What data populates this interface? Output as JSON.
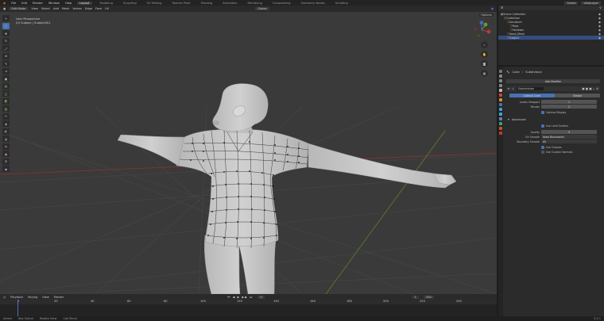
{
  "topbar": {
    "menus": [
      "File",
      "Edit",
      "Render",
      "Window",
      "Help"
    ],
    "workspaces": [
      "Layout",
      "Modeling",
      "Sculpting",
      "UV Editing",
      "Texture Paint",
      "Shading",
      "Animation",
      "Rendering",
      "Compositing",
      "Geometry Nodes",
      "Scripting"
    ],
    "active_workspace": "Layout",
    "scene": "Scene",
    "view_layer": "ViewLayer"
  },
  "viewport_header": {
    "mode": "Edit Mode",
    "menus": [
      "View",
      "Select",
      "Add",
      "Mesh",
      "Vertex",
      "Edge",
      "Face",
      "UV"
    ],
    "transform": "Global"
  },
  "viewport": {
    "view_name": "User Perspective",
    "object_info": "(0) Subject | Subject001",
    "options_label": "Options"
  },
  "timeline": {
    "menus": [
      "Playback",
      "Keying",
      "View",
      "Marker"
    ],
    "current_frame": "0",
    "start": "1",
    "end": "250",
    "ruler": [
      "0",
      "20",
      "40",
      "60",
      "80",
      "100",
      "120",
      "140",
      "160",
      "180",
      "200",
      "220",
      "240"
    ]
  },
  "status_bar": {
    "items": [
      "Select",
      "Box Select",
      "Rotate View",
      "Call Menu"
    ],
    "version": "3.3.1"
  },
  "outliner": {
    "rows": [
      {
        "label": "Scene Collection",
        "indent": 0,
        "selected": false
      },
      {
        "label": "Collection",
        "indent": 1,
        "selected": false
      },
      {
        "label": "Armature",
        "indent": 2,
        "selected": false
      },
      {
        "label": "Pose",
        "indent": 3,
        "selected": false
      },
      {
        "label": "Skeleton",
        "indent": 3,
        "selected": false
      },
      {
        "label": "Head_Mesh",
        "indent": 2,
        "selected": false
      },
      {
        "label": "Subject",
        "indent": 2,
        "selected": true
      }
    ]
  },
  "properties": {
    "object_name": "Cube",
    "modifier_label": "Subdivision",
    "add_modifier": "Add Modifier",
    "modifier_name": "Subdivision",
    "tabs": [
      "Catmull-Clark",
      "Simple"
    ],
    "levels_viewport_label": "Levels Viewport",
    "levels_viewport": "1",
    "render_label": "Render",
    "render": "2",
    "optimal_display": "Optimal Display",
    "advanced_label": "Advanced",
    "use_limit_surface": "Use Limit Surface",
    "quality_label": "Quality",
    "quality": "3",
    "uv_smooth_label": "UV Smooth",
    "uv_smooth": "Keep Boundaries",
    "boundary_smooth_label": "Boundary Smooth",
    "boundary_smooth": "All",
    "use_creases": "Use Creases",
    "use_custom_normals": "Use Custom Normals"
  },
  "colors": {
    "accent": "#4772b3",
    "viewport_bg": "#3a3a3a",
    "mesh": "#c9c9c9",
    "axis_x": "#b53b3b",
    "axis_y": "#6d9a32",
    "axis_z": "#3f6dbf"
  }
}
